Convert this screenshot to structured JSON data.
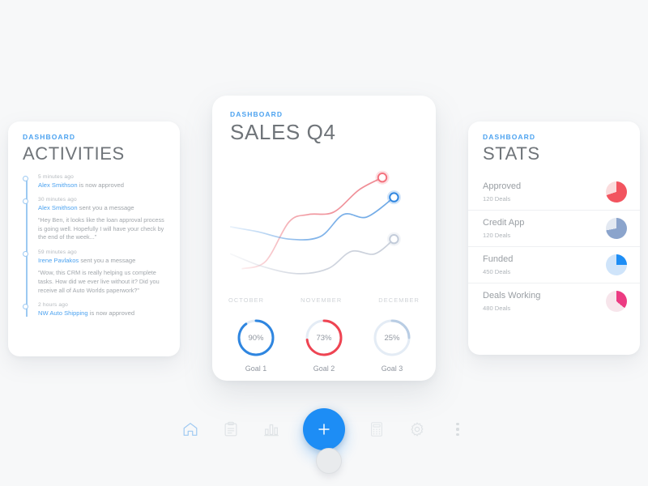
{
  "background_color": "#f7f8f9",
  "accent_blue": "#4da3f0",
  "fab_blue": "#1d8df5",
  "activities": {
    "eyebrow": "DASHBOARD",
    "title": "ACTIVITIES",
    "events": [
      {
        "time": "5 minutes ago",
        "who": "Alex Smithson",
        "action": " is now approved",
        "quote": ""
      },
      {
        "time": "30 minutes ago",
        "who": "Alex Smithson",
        "action": " sent you a message",
        "quote": "“Hey Ben, it looks like the loan approval process is going well. Hopefully I will have your check by the end of the week...”"
      },
      {
        "time": "59 minutes ago",
        "who": "Irene Pavlakos",
        "action": " sent you a message",
        "quote": "“Wow, this CRM is really helping us complete tasks.  How did we ever live without it?  Did you receive all of Auto Worlds paperwork?”"
      },
      {
        "time": "2 hours ago",
        "who": "NW Auto Shipping",
        "action": " is now approved",
        "quote": ""
      }
    ]
  },
  "sales": {
    "eyebrow": "DASHBOARD",
    "title": "SALES Q4",
    "goals": [
      {
        "label": "Goal 1",
        "value": "90%",
        "percent": 90,
        "color": "#2f86e0"
      },
      {
        "label": "Goal 2",
        "value": "73%",
        "percent": 73,
        "color": "#ef4452"
      },
      {
        "label": "Goal 3",
        "value": "25%",
        "percent": 25,
        "color": "#b9cde4"
      }
    ]
  },
  "chart_data": {
    "type": "line",
    "title": "SALES Q4",
    "xlabel": "",
    "ylabel": "",
    "grid": false,
    "legend": "none",
    "x": [
      "OCTOBER",
      "NOVEMBER",
      "DECEMBER"
    ],
    "tick_labels": [
      "OCTOBER",
      "NOVEMBER",
      "DECEMBER"
    ],
    "xlim": [
      0,
      100
    ],
    "ylim": [
      0,
      100
    ],
    "series": [
      {
        "name": "red",
        "color": "#ef8a93",
        "endpoint_marker": true,
        "endpoint_color": "#f4737f",
        "x": [
          8,
          20,
          32,
          42,
          55,
          68,
          80
        ],
        "values": [
          14,
          20,
          52,
          58,
          60,
          78,
          88
        ]
      },
      {
        "name": "blue",
        "color": "#6fa9e6",
        "endpoint_marker": true,
        "endpoint_color": "#2f86e0",
        "x": [
          2,
          16,
          32,
          48,
          60,
          72,
          86
        ],
        "values": [
          48,
          44,
          38,
          40,
          58,
          56,
          72
        ]
      },
      {
        "name": "gray",
        "color": "#c9cfda",
        "endpoint_marker": true,
        "endpoint_color": "#c3ccda",
        "x": [
          2,
          18,
          36,
          52,
          64,
          76,
          86
        ],
        "values": [
          26,
          16,
          10,
          14,
          28,
          26,
          38
        ]
      }
    ]
  },
  "stats": {
    "eyebrow": "DASHBOARD",
    "title": "STATS",
    "rows": [
      {
        "name": "Approved",
        "deals": "120 Deals",
        "percent": 70,
        "color": "#f2545f",
        "track": "#fbdcdd"
      },
      {
        "name": "Credit App",
        "deals": "120 Deals",
        "percent": 72,
        "color": "#8ba4cc",
        "track": "#e3e9f2"
      },
      {
        "name": "Funded",
        "deals": "450 Deals",
        "percent": 25,
        "color": "#1d8df5",
        "track": "#cfe4fa"
      },
      {
        "name": "Deals Working",
        "deals": "480 Deals",
        "percent": 36,
        "color": "#ec3b82",
        "track": "#f7e5eb"
      }
    ]
  },
  "toolbar": {
    "items": [
      {
        "icon": "home-icon",
        "active": true
      },
      {
        "icon": "clipboard-icon",
        "active": false
      },
      {
        "icon": "bar-chart-icon",
        "active": false
      },
      {
        "icon": "add-icon",
        "active": false
      },
      {
        "icon": "calculator-icon",
        "active": false
      },
      {
        "icon": "gear-icon",
        "active": false
      },
      {
        "icon": "more-options-icon",
        "active": false
      }
    ],
    "home_button": "home-button"
  }
}
